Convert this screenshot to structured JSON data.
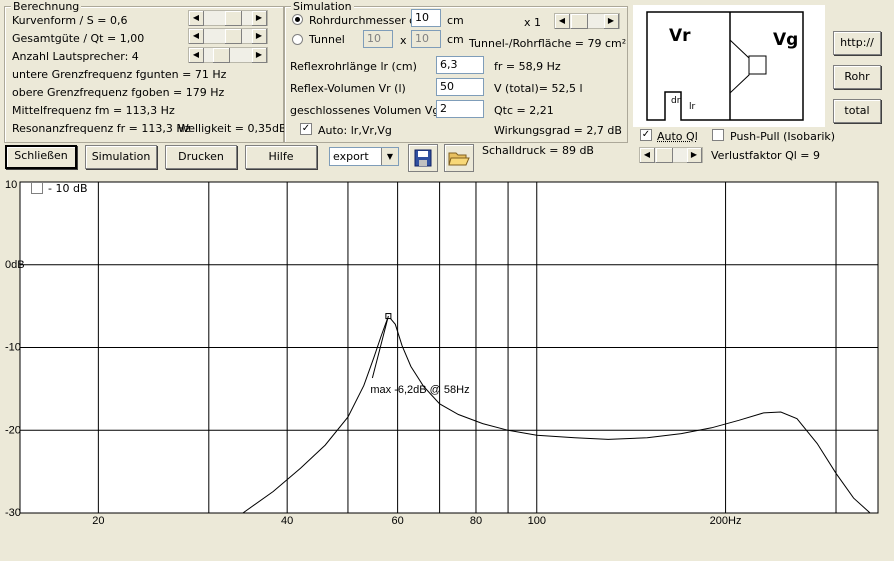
{
  "berechnung": {
    "legend": "Berechnung",
    "kurvenform": "Kurvenform / S = 0,6",
    "gesamtguete": "Gesamtgüte / Qt = 1,00",
    "anzahl": "Anzahl Lautsprecher: 4",
    "fgunten": "untere Grenzfrequenz fgunten = 71 Hz",
    "fgoben": "obere Grenzfrequenz fgoben = 179 Hz",
    "fm": "Mittelfrequenz fm = 113,3 Hz",
    "fr": "Resonanzfrequenz fr = 113,3 Hz",
    "welligkeit": "Welligkeit = 0,35dB"
  },
  "simulation": {
    "legend": "Simulation",
    "radio_rohr": "Rohrdurchmesser dr",
    "radio_tunnel": "Tunnel",
    "dr_value": "10",
    "dr_unit": "cm",
    "x1_label": "x 1",
    "tunnel_w": "10",
    "tunnel_x": "x",
    "tunnel_h": "10",
    "tunnel_unit": "cm",
    "tunnel_flaeche": "Tunnel-/Rohrfläche = 79 cm²",
    "lr_label": "Reflexrohrlänge lr (cm)",
    "lr_value": "6,3",
    "fr_result": "fr = 58,9 Hz",
    "vr_label": "Reflex-Volumen Vr (l)",
    "vr_value": "50",
    "vtotal": "V (total)= 52,5 l",
    "vg_label": "geschlossenes Volumen Vg (l)",
    "vg_value": "2",
    "qtc": "Qtc = 2,21",
    "auto_label": "Auto: lr,Vr,Vg",
    "wirkungsgrad": "Wirkungsgrad = 2,7 dB"
  },
  "diagram": {
    "vr": "Vr",
    "vg": "Vg",
    "dr": "dr",
    "lr": "lr"
  },
  "right_buttons": {
    "http": "http://",
    "rohr": "Rohr",
    "total": "total"
  },
  "options": {
    "auto_ql": "Auto Ql",
    "pushpull": "Push-Pull (Isobarik)",
    "verlustfaktor": "Verlustfaktor Ql = 9"
  },
  "toolbar": {
    "schliessen": "Schließen",
    "simulation": "Simulation",
    "drucken": "Drucken",
    "hilfe": "Hilfe",
    "export_value": "export",
    "schalldruck": "Schalldruck = 89 dB"
  },
  "chart_toggle": "- 10 dB",
  "chart_data": {
    "type": "line",
    "title": "",
    "xlabel": "",
    "ylabel": "",
    "x_scale": "log",
    "xlim": [
      15,
      350
    ],
    "ylim": [
      -30,
      10
    ],
    "y_ticks": [
      {
        "v": 10,
        "label": "10"
      },
      {
        "v": 0,
        "label": "0dB"
      },
      {
        "v": -10,
        "label": "-10"
      },
      {
        "v": -20,
        "label": "-20"
      },
      {
        "v": -30,
        "label": "-30"
      }
    ],
    "x_ticks": [
      {
        "v": 20,
        "label": "20"
      },
      {
        "v": 40,
        "label": "40"
      },
      {
        "v": 60,
        "label": "60"
      },
      {
        "v": 80,
        "label": "80"
      },
      {
        "v": 100,
        "label": "100"
      },
      {
        "v": 200,
        "label": "200Hz"
      }
    ],
    "x_grid": [
      20,
      30,
      40,
      50,
      60,
      70,
      80,
      90,
      100,
      200,
      300
    ],
    "annotation": "max -6,2dB @ 58Hz",
    "peak": {
      "x": 58,
      "y": -6.2
    },
    "series": [
      {
        "x": [
          34,
          38,
          42,
          46,
          50,
          53,
          55,
          56.5,
          58,
          59.5,
          61,
          63,
          66,
          70,
          75,
          82,
          90,
          100,
          115,
          130,
          150,
          170,
          190,
          210,
          230,
          245,
          260,
          280,
          300,
          320,
          340
        ],
        "y": [
          -30,
          -27.4,
          -24.6,
          -21.8,
          -18.4,
          -14.6,
          -11.2,
          -8.6,
          -6.2,
          -7.2,
          -9.8,
          -12.3,
          -14.7,
          -16.8,
          -18.1,
          -19.2,
          -20,
          -20.6,
          -20.9,
          -21.1,
          -20.9,
          -20.4,
          -19.7,
          -18.8,
          -17.9,
          -17.8,
          -18.6,
          -21.6,
          -25.2,
          -28.2,
          -30.6
        ]
      }
    ]
  }
}
